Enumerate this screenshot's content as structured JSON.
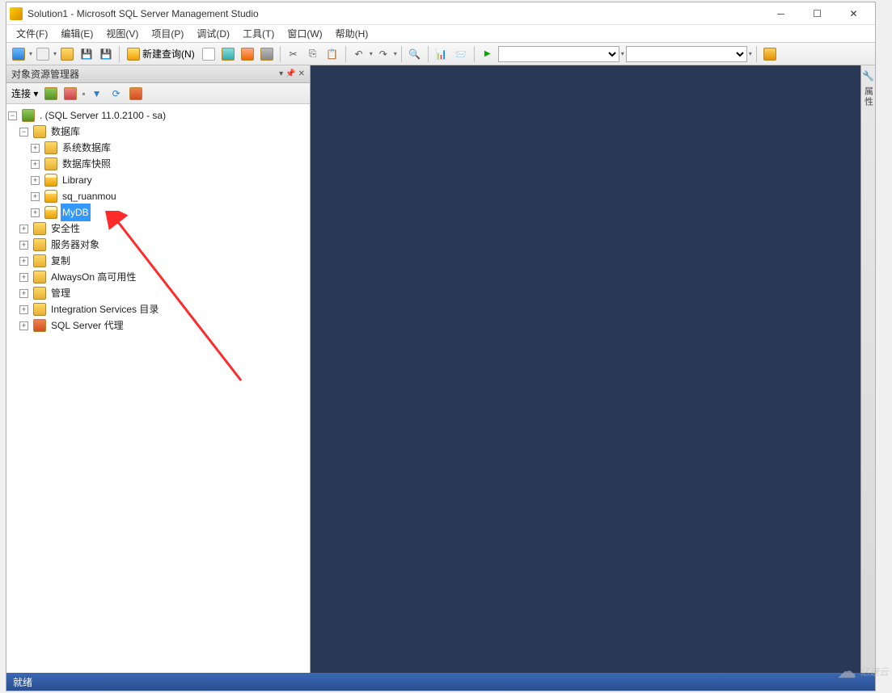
{
  "titlebar": {
    "title": "Solution1 - Microsoft SQL Server Management Studio"
  },
  "menu": {
    "file": "文件(F)",
    "edit": "编辑(E)",
    "view": "视图(V)",
    "project": "项目(P)",
    "debug": "调试(D)",
    "tools": "工具(T)",
    "window": "窗口(W)",
    "help": "帮助(H)"
  },
  "toolbar": {
    "new_query": "新建查询(N)"
  },
  "explorer": {
    "panel_title": "对象资源管理器",
    "connect_label": "连接 ▾",
    "root": ". (SQL Server 11.0.2100 - sa)",
    "databases": "数据库",
    "sys_db": "系统数据库",
    "db_snap": "数据库快照",
    "db1": "Library",
    "db2": "sq_ruanmou",
    "db3": "MyDB",
    "security": "安全性",
    "server_obj": "服务器对象",
    "replication": "复制",
    "alwayson": "AlwaysOn 高可用性",
    "management": "管理",
    "isc": "Integration Services 目录",
    "agent": "SQL Server 代理"
  },
  "right_gutter": {
    "properties": "属性"
  },
  "statusbar": {
    "ready": "就绪"
  },
  "watermark": "亿速云"
}
